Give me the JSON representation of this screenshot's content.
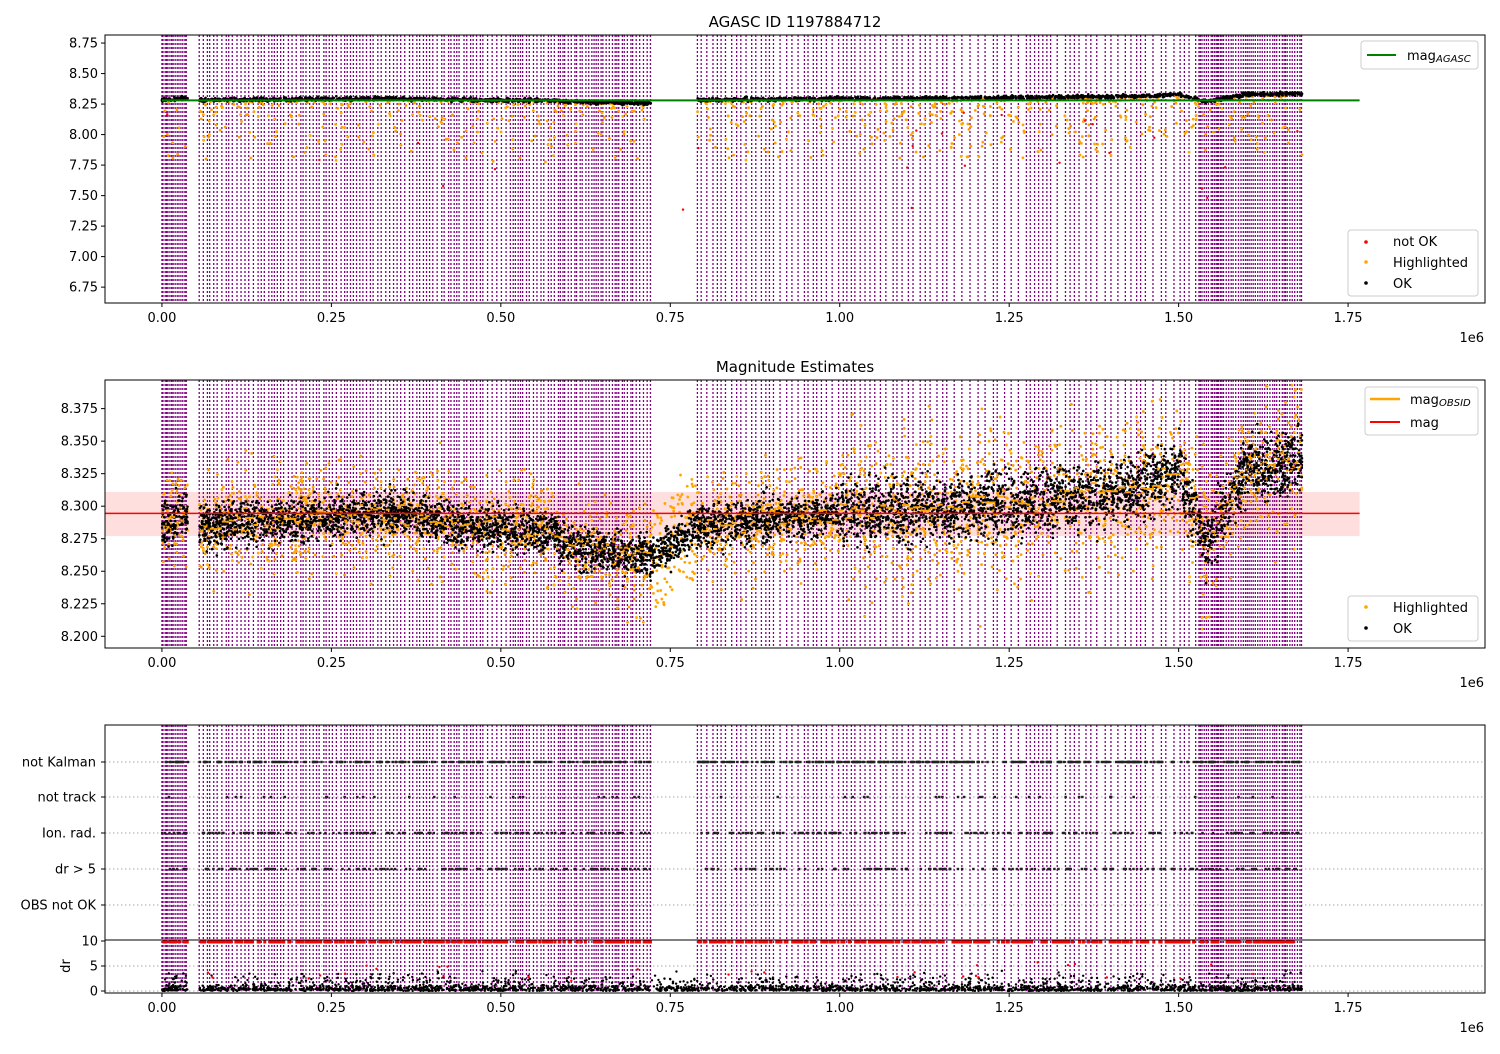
{
  "chart_data": [
    {
      "type": "scatter",
      "title": "AGASC ID 1197884712",
      "xlabel": "",
      "ylabel": "",
      "x_offset_label": "1e6",
      "xlim": [
        -84000,
        1952000
      ],
      "ylim": [
        6.62,
        8.816
      ],
      "xticks": [
        "0.00",
        "0.25",
        "0.50",
        "0.75",
        "1.00",
        "1.25",
        "1.50",
        "1.75"
      ],
      "yticks": [
        "6.75",
        "7.00",
        "7.25",
        "7.50",
        "7.75",
        "8.00",
        "8.25",
        "8.50",
        "8.75"
      ],
      "series": [
        {
          "name": "mag_AGASC",
          "kind": "line",
          "color": "#008000",
          "y": 8.28,
          "x_range": [
            0,
            1767000
          ]
        },
        {
          "name": "not OK",
          "kind": "points",
          "color": "#ff0000"
        },
        {
          "name": "Highlighted",
          "kind": "points",
          "color": "#ffa500"
        },
        {
          "name": "OK",
          "kind": "points",
          "color": "#000000",
          "y_range": [
            8.25,
            8.36
          ]
        }
      ],
      "legend": [
        {
          "label_main": "mag",
          "label_sub": "AGASC",
          "color": "#008000",
          "placement": "top-right"
        },
        {
          "label": "not OK",
          "color": "#ff0000",
          "placement": "bottom-right"
        },
        {
          "label": "Highlighted",
          "color": "#ffa500",
          "placement": "bottom-right"
        },
        {
          "label": "OK",
          "color": "#000000",
          "placement": "bottom-right"
        }
      ],
      "obsid_boundary_color": "#800080"
    },
    {
      "type": "scatter",
      "title": "Magnitude Estimates",
      "x_offset_label": "1e6",
      "xlim": [
        -84000,
        1952000
      ],
      "ylim": [
        8.191,
        8.397
      ],
      "xticks": [
        "0.00",
        "0.25",
        "0.50",
        "0.75",
        "1.00",
        "1.25",
        "1.50",
        "1.75"
      ],
      "yticks": [
        "8.200",
        "8.225",
        "8.250",
        "8.275",
        "8.300",
        "8.325",
        "8.350",
        "8.375"
      ],
      "series": [
        {
          "name": "mag_OBSID",
          "kind": "step",
          "color": "#ffa500"
        },
        {
          "name": "mag",
          "kind": "line",
          "color": "#ff0000",
          "y": 8.2945,
          "band": [
            8.277,
            8.311
          ]
        },
        {
          "name": "Highlighted",
          "kind": "points",
          "color": "#ffa500"
        },
        {
          "name": "OK",
          "kind": "points",
          "color": "#000000"
        }
      ],
      "legend": [
        {
          "label_main": "mag",
          "label_sub": "OBSID",
          "color": "#ffa500",
          "placement": "top-right"
        },
        {
          "label": "mag",
          "color": "#ff0000",
          "placement": "top-right"
        },
        {
          "label": "Highlighted",
          "color": "#ffa500",
          "placement": "bottom-right"
        },
        {
          "label": "OK",
          "color": "#000000",
          "placement": "bottom-right"
        }
      ]
    },
    {
      "type": "scatter",
      "title": "",
      "categories": [
        "not Kalman",
        "not track",
        "Ion. rad.",
        "dr > 5",
        "OBS not OK"
      ],
      "grid": "dotted"
    },
    {
      "type": "scatter",
      "ylabel": "dr",
      "x_offset_label": "1e6",
      "ylim": [
        -0.4,
        10.2
      ],
      "yticks": [
        "0",
        "5",
        "10"
      ],
      "xticks": [
        "0.00",
        "0.25",
        "0.50",
        "0.75",
        "1.00",
        "1.25",
        "1.50",
        "1.75"
      ],
      "grid": "dotted"
    }
  ]
}
